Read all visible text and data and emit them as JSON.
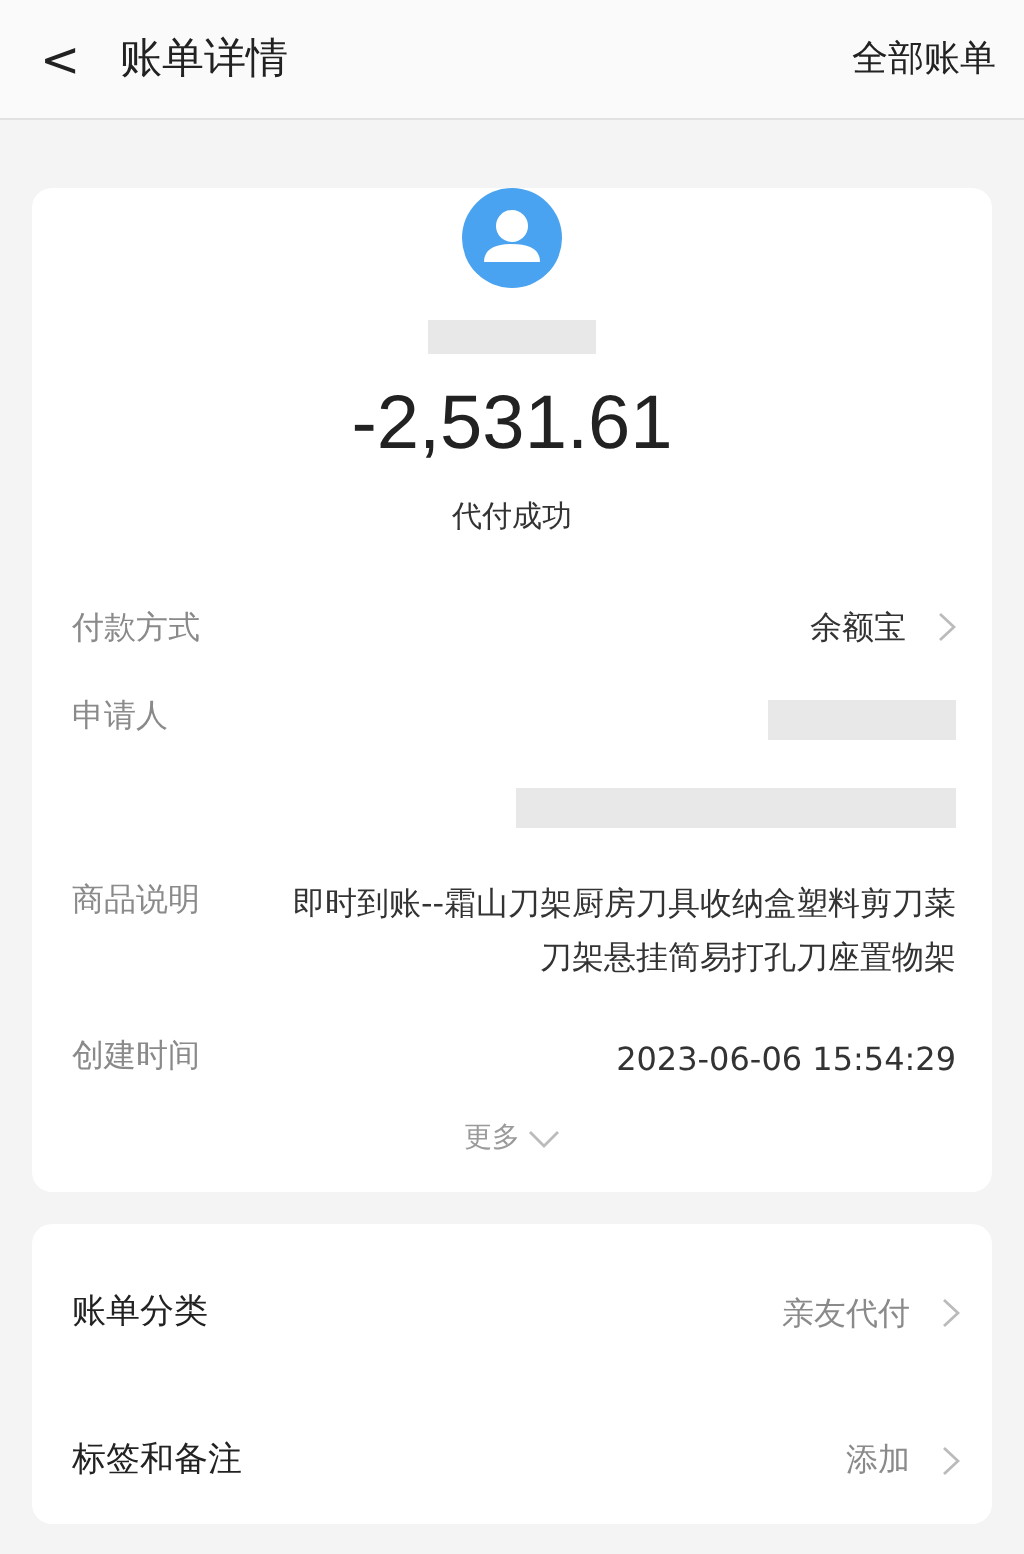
{
  "header": {
    "back": "<",
    "title": "账单详情",
    "action": "全部账单"
  },
  "summary": {
    "name_redacted": true,
    "amount": "-2,531.61",
    "status": "代付成功"
  },
  "details": [
    {
      "kind": "link",
      "label": "付款方式",
      "value": "余额宝"
    },
    {
      "kind": "redacted",
      "label": "申请人"
    },
    {
      "kind": "text",
      "label": "商品说明",
      "value": "即时到账--霜山刀架厨房刀具收纳盒塑料剪刀菜刀架悬挂简易打孔刀座置物架"
    },
    {
      "kind": "text",
      "label": "创建时间",
      "value": "2023-06-06 15:54:29"
    }
  ],
  "more": {
    "label": "更多",
    "expanded": false
  },
  "extras": [
    {
      "label": "账单分类",
      "value": "亲友代付"
    },
    {
      "label": "标签和备注",
      "value": "添加"
    }
  ]
}
